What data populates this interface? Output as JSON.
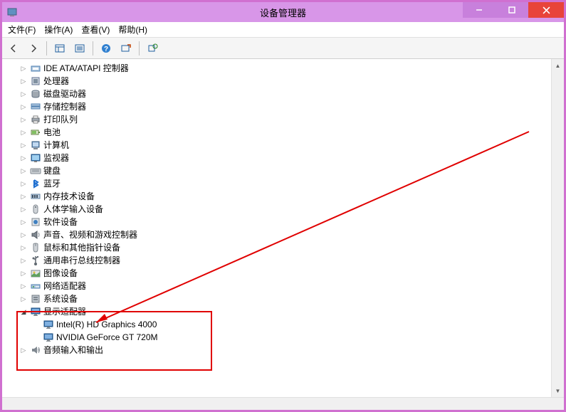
{
  "window": {
    "title": "设备管理器"
  },
  "menu": {
    "file": "文件(F)",
    "action": "操作(A)",
    "view": "查看(V)",
    "help": "帮助(H)"
  },
  "tree": {
    "items": [
      {
        "label": "IDE ATA/ATAPI 控制器",
        "icon": "ide"
      },
      {
        "label": "处理器",
        "icon": "cpu"
      },
      {
        "label": "磁盘驱动器",
        "icon": "disk"
      },
      {
        "label": "存储控制器",
        "icon": "storage"
      },
      {
        "label": "打印队列",
        "icon": "printer"
      },
      {
        "label": "电池",
        "icon": "battery"
      },
      {
        "label": "计算机",
        "icon": "computer"
      },
      {
        "label": "监视器",
        "icon": "monitor"
      },
      {
        "label": "键盘",
        "icon": "keyboard"
      },
      {
        "label": "蓝牙",
        "icon": "bluetooth"
      },
      {
        "label": "内存技术设备",
        "icon": "memory"
      },
      {
        "label": "人体学输入设备",
        "icon": "hid"
      },
      {
        "label": "软件设备",
        "icon": "software"
      },
      {
        "label": "声音、视频和游戏控制器",
        "icon": "sound"
      },
      {
        "label": "鼠标和其他指针设备",
        "icon": "mouse"
      },
      {
        "label": "通用串行总线控制器",
        "icon": "usb"
      },
      {
        "label": "图像设备",
        "icon": "image"
      },
      {
        "label": "网络适配器",
        "icon": "network"
      },
      {
        "label": "系统设备",
        "icon": "system"
      },
      {
        "label": "显示适配器",
        "icon": "display",
        "expanded": true,
        "children": [
          {
            "label": "Intel(R) HD Graphics 4000"
          },
          {
            "label": "NVIDIA GeForce GT 720M"
          }
        ]
      },
      {
        "label": "音频输入和输出",
        "icon": "audio"
      }
    ]
  }
}
